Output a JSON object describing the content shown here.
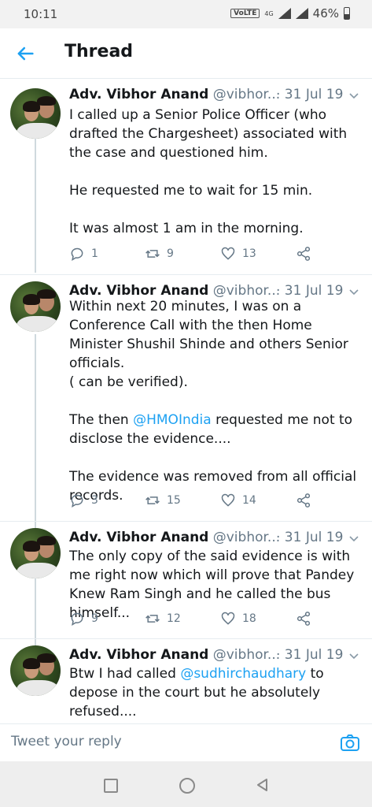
{
  "status_bar": {
    "time": "10:11",
    "volte": "VoLTE",
    "network": "4G",
    "battery": "46%"
  },
  "app_bar": {
    "title": "Thread"
  },
  "tweets": [
    {
      "name": "Adv. Vibhor Anand",
      "handle": "@vibhor...",
      "date": "· 31 Jul 19",
      "body_parts": [
        "I called up a Senior Police Officer (who drafted the Chargesheet) associated with the case and questioned him.\n\nHe requested me to wait for 15 min.\n\nIt was almost 1 am in the morning."
      ],
      "replies": "1",
      "retweets": "9",
      "likes": "13"
    },
    {
      "name": "Adv. Vibhor Anand",
      "handle": "@vibhor...",
      "date": "· 31 Jul 19",
      "body_before": "Within next 20 minutes, I was on a Conference Call with the then Home Minister Shushil Shinde and others Senior officials.\n( can be verified).\n\nThe then ",
      "mention": "@HMOIndia",
      "body_after": " requested me not to disclose the evidence....\n\nThe evidence was removed from all official records.",
      "replies": "3",
      "retweets": "15",
      "likes": "14"
    },
    {
      "name": "Adv. Vibhor Anand",
      "handle": "@vibhor...",
      "date": "· 31 Jul 19",
      "body_parts": [
        "The only copy of the said evidence is with me right now which will prove that Pandey Knew Ram Singh and he called the bus himself..."
      ],
      "replies": "9",
      "retweets": "12",
      "likes": "18"
    },
    {
      "name": "Adv. Vibhor Anand",
      "handle": "@vibhor...",
      "date": "· 31 Jul 19",
      "body_before": "Btw I had called ",
      "mention": "@sudhirchaudhary",
      "body_after": " to depose in the court but he absolutely refused...."
    }
  ],
  "reply_bar": {
    "placeholder": "Tweet your reply"
  },
  "icons": {
    "back": "back-arrow-icon",
    "caret": "chevron-down-icon",
    "reply": "reply-icon",
    "retweet": "retweet-icon",
    "like": "heart-icon",
    "share": "share-icon",
    "camera": "camera-icon"
  },
  "colors": {
    "accent": "#1da1f2",
    "text": "#14171a",
    "secondary": "#657786"
  }
}
